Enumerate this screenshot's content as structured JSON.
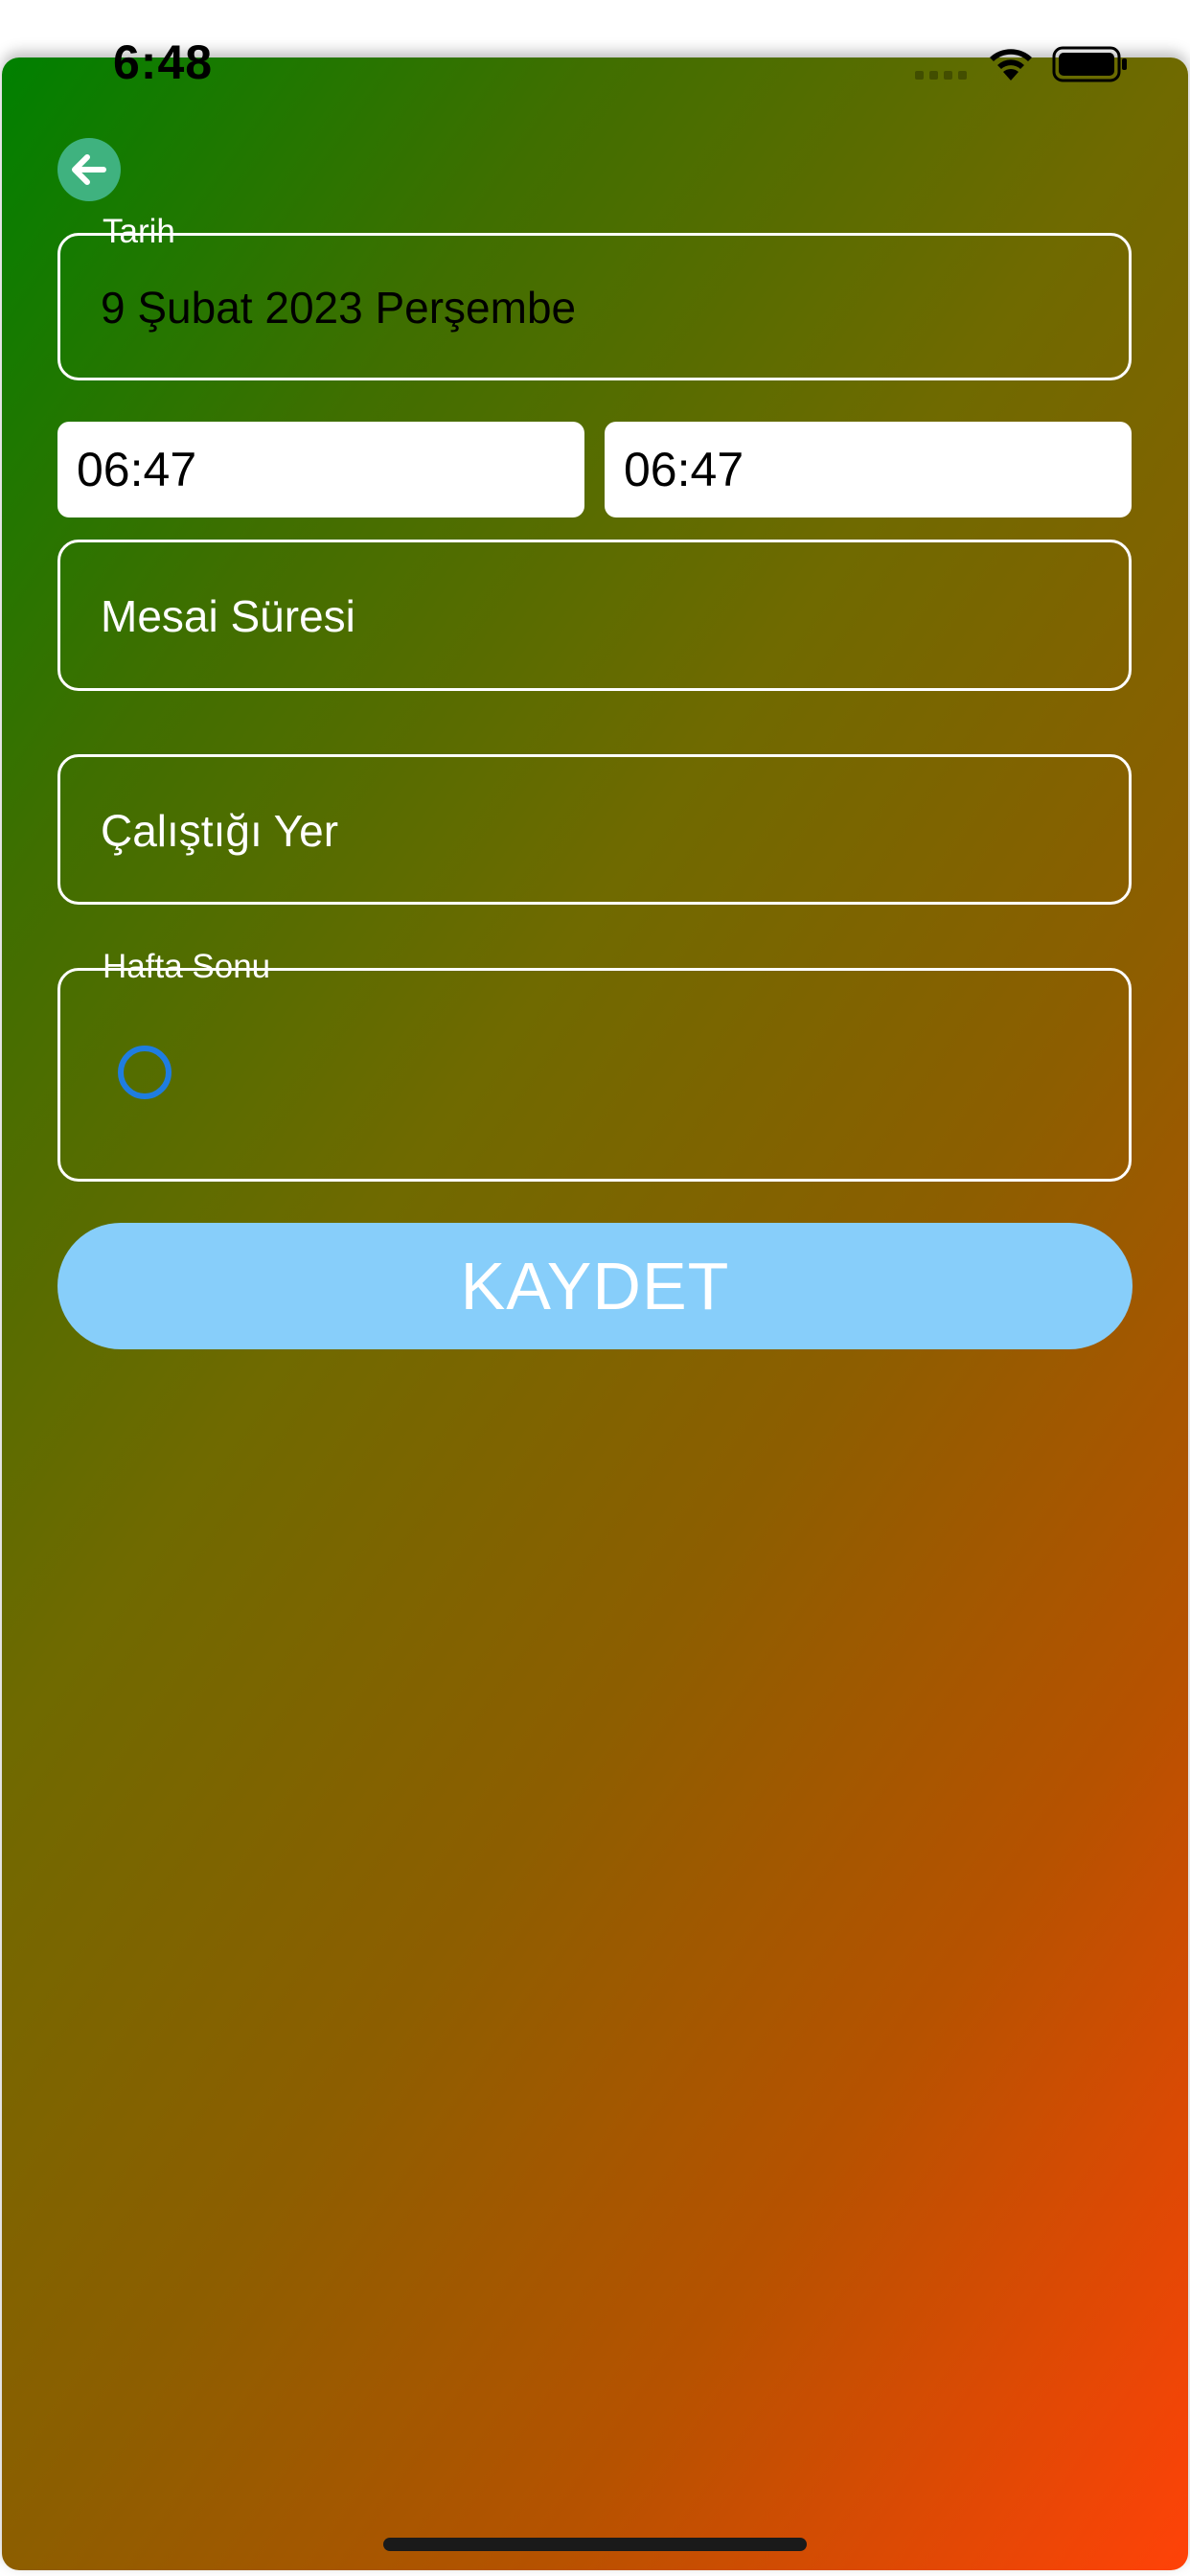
{
  "status_bar": {
    "time": "6:48"
  },
  "form": {
    "date_label": "Tarih",
    "date_value": "9 Şubat 2023 Perşembe",
    "start_time": "06:47",
    "end_time": "06:47",
    "duration_placeholder": "Mesai Süresi",
    "location_placeholder": "Çalıştığı Yer",
    "weekend_label": "Hafta Sonu",
    "weekend_selected": false,
    "save_label": "KAYDET"
  },
  "colors": {
    "gradient_start": "#008000",
    "gradient_end": "#ff4208",
    "save_button": "#87cefa",
    "back_button": "#3fb27f",
    "radio_border": "#1f7de0"
  },
  "icons": {
    "back": "arrow-left-circle-icon",
    "wifi": "wifi-icon",
    "battery": "battery-icon",
    "signal": "cellular-signal-icon"
  }
}
